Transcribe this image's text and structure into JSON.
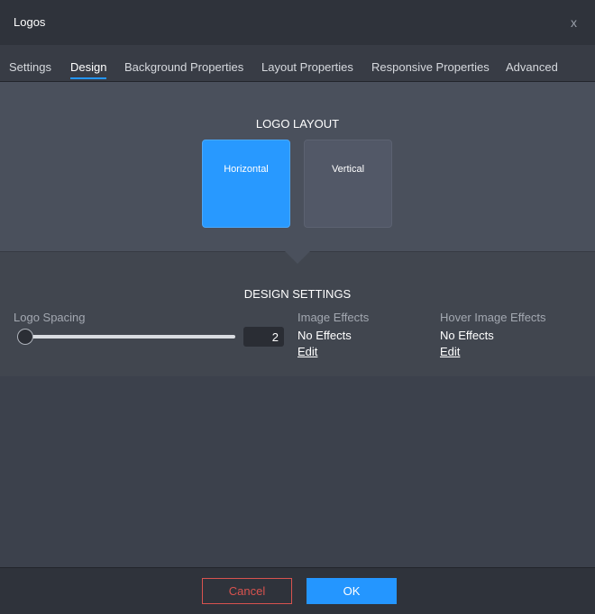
{
  "dialog": {
    "title": "Logos",
    "close_label": "x"
  },
  "tabs": [
    {
      "label": "Settings"
    },
    {
      "label": "Design",
      "active": true
    },
    {
      "label": "Background Properties"
    },
    {
      "label": "Layout Properties"
    },
    {
      "label": "Responsive Properties"
    },
    {
      "label": "Advanced"
    }
  ],
  "logo_layout": {
    "title": "LOGO LAYOUT",
    "options": [
      {
        "label": "Horizontal",
        "selected": true
      },
      {
        "label": "Vertical",
        "selected": false
      }
    ]
  },
  "design_settings": {
    "title": "DESIGN SETTINGS",
    "logo_spacing": {
      "label": "Logo Spacing",
      "value": "2",
      "slider_fraction": 0.0
    },
    "image_effects": {
      "label": "Image Effects",
      "value": "No Effects",
      "edit_label": "Edit"
    },
    "hover_image_effects": {
      "label": "Hover Image Effects",
      "value": "No Effects",
      "edit_label": "Edit"
    }
  },
  "footer": {
    "cancel_label": "Cancel",
    "ok_label": "OK"
  },
  "colors": {
    "accent": "#2496ff",
    "cancel": "#d9534f",
    "background": "#3c414c"
  }
}
